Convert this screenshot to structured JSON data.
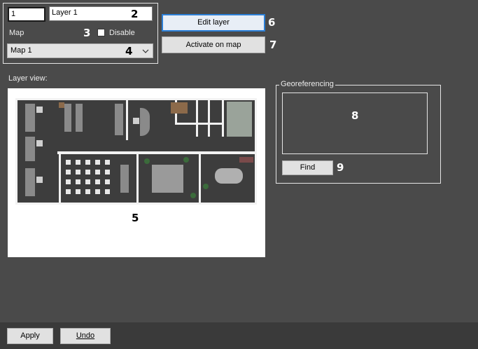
{
  "layer": {
    "number_value": "1",
    "name_value": "Layer 1",
    "map_label": "Map",
    "disable_label": "Disable",
    "disable_checked": false,
    "map_select_value": "Map 1"
  },
  "actions": {
    "edit_layer_label": "Edit layer",
    "activate_on_map_label": "Activate on map"
  },
  "layer_view": {
    "label": "Layer view:"
  },
  "georeferencing": {
    "legend": "Georeferencing",
    "find_label": "Find"
  },
  "callouts": [
    "1",
    "2",
    "3",
    "4",
    "5",
    "6",
    "7",
    "8",
    "9"
  ],
  "footer": {
    "apply_label": "Apply",
    "undo_label": "Undo"
  },
  "icons": {
    "dropdown": "chevron-down-icon"
  }
}
